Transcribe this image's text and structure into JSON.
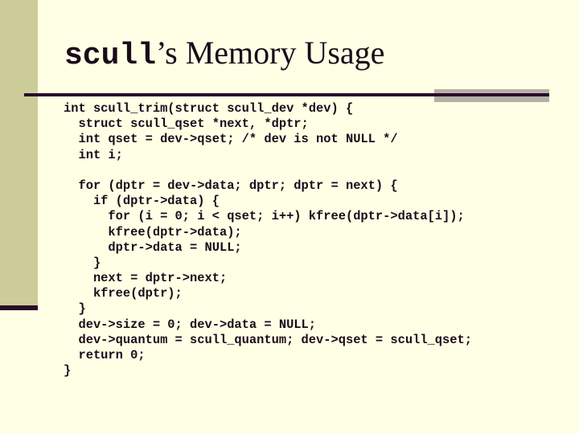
{
  "slide": {
    "title_code": "scull",
    "title_rest": "’s Memory Usage",
    "code_lines": [
      "int scull_trim(struct scull_dev *dev) {",
      "  struct scull_qset *next, *dptr;",
      "  int qset = dev->qset; /* dev is not NULL */",
      "  int i;",
      "",
      "  for (dptr = dev->data; dptr; dptr = next) {",
      "    if (dptr->data) {",
      "      for (i = 0; i < qset; i++) kfree(dptr->data[i]);",
      "      kfree(dptr->data);",
      "      dptr->data = NULL;",
      "    }",
      "    next = dptr->next;",
      "    kfree(dptr);",
      "  }",
      "  dev->size = 0; dev->data = NULL;",
      "  dev->quantum = scull_quantum; dev->qset = scull_qset;",
      "  return 0;",
      "}"
    ]
  },
  "colors": {
    "background": "#ffffe5",
    "side_bar": "#cccc99",
    "accent_dark": "#2a0a2a",
    "accent_gray": "#b3b0a8"
  }
}
